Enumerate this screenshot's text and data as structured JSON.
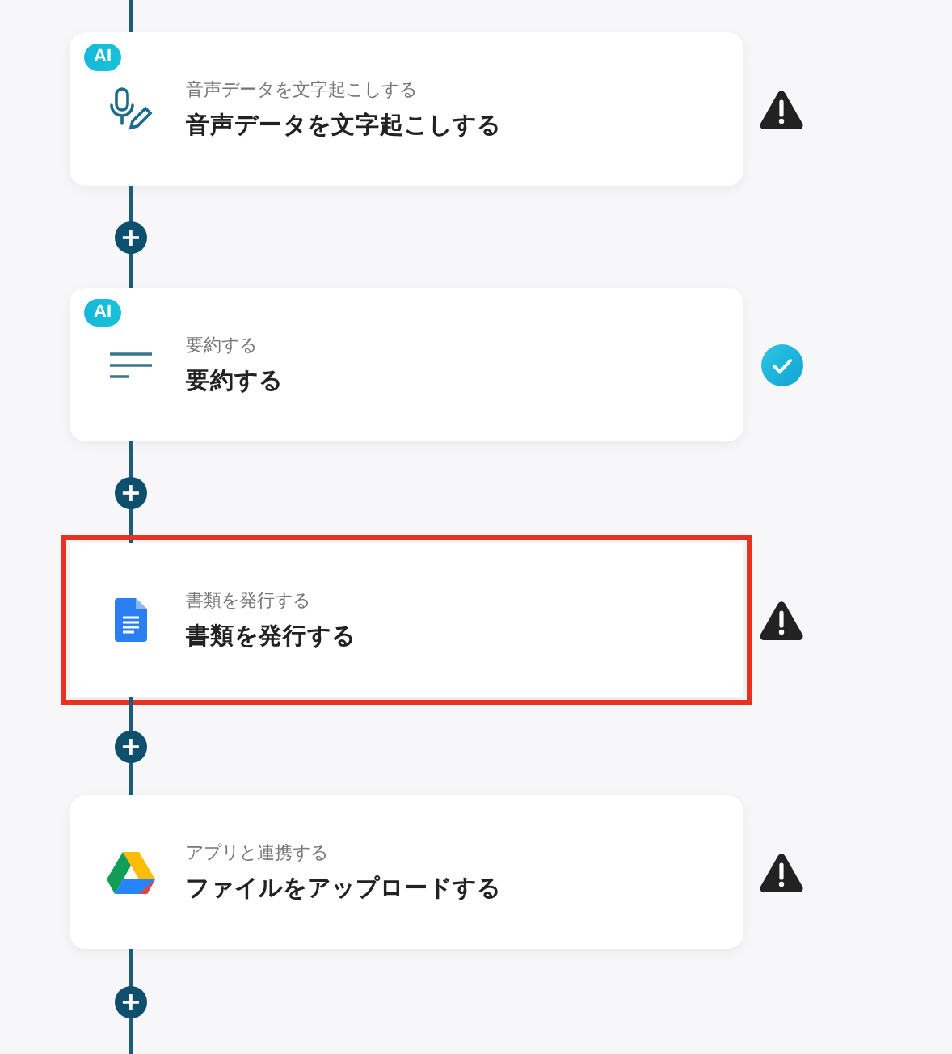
{
  "steps": [
    {
      "badge": "AI",
      "subtitle": "音声データを文字起こしする",
      "title": "音声データを文字起こしする",
      "completed": false,
      "highlighted": false
    },
    {
      "badge": "AI",
      "subtitle": "要約する",
      "title": "要約する",
      "completed": true,
      "highlighted": false
    },
    {
      "subtitle": "書類を発行する",
      "title": "書類を発行する",
      "completed": false,
      "highlighted": true
    },
    {
      "subtitle": "アプリと連携する",
      "title": "ファイルをアップロードする",
      "completed": false,
      "highlighted": false
    }
  ],
  "add_buttons": [
    "+",
    "+",
    "+",
    "+"
  ]
}
